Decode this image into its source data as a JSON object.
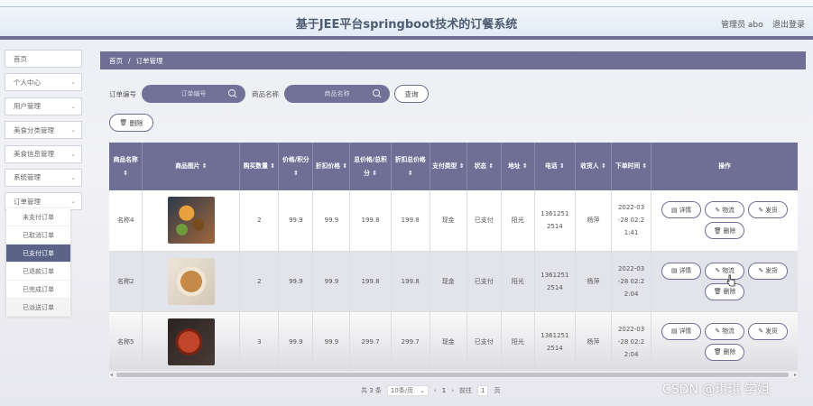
{
  "header": {
    "title": "基于JEE平台springboot技术的订餐系统",
    "user": "管理员 abo",
    "logout": "退出登录"
  },
  "sidebar": {
    "items": [
      {
        "label": "首页",
        "chevron": false
      },
      {
        "label": "个人中心",
        "chevron": true
      },
      {
        "label": "用户管理",
        "chevron": true
      },
      {
        "label": "美食分类管理",
        "chevron": true
      },
      {
        "label": "美食信息管理",
        "chevron": true
      },
      {
        "label": "系统管理",
        "chevron": true
      },
      {
        "label": "订单管理",
        "chevron": true
      }
    ],
    "submenu": [
      {
        "label": "未支付订单",
        "active": false
      },
      {
        "label": "已取消订单",
        "active": false
      },
      {
        "label": "已支付订单",
        "active": true
      },
      {
        "label": "已退款订单",
        "active": false
      },
      {
        "label": "已完成订单",
        "active": false
      },
      {
        "label": "已派送订单",
        "active": false
      }
    ]
  },
  "breadcrumb": {
    "home": "首页",
    "sep": "/",
    "current": "订单管理"
  },
  "search": {
    "order_no_label": "订单编号",
    "order_no_placeholder": "订单编号",
    "goods_name_label": "商品名称",
    "goods_name_placeholder": "商品名称",
    "query_button": "查询",
    "delete_button": "删除"
  },
  "table": {
    "headers": [
      "商品名称 ⇕",
      "商品图片 ⇕",
      "购买数量 ⇕",
      "价格/积分 ⇕",
      "折扣价格 ⇕",
      "总价格/总积分 ⇕",
      "折扣总价格 ⇕",
      "支付类型 ⇕",
      "状态 ⇕",
      "地址 ⇕",
      "电话 ⇕",
      "收货人 ⇕",
      "下单时间 ⇕",
      "操作"
    ],
    "rows": [
      {
        "name": "名称4",
        "qty": "2",
        "price": "99.9",
        "discount_price": "99.9",
        "total": "199.8",
        "discount_total": "199.8",
        "pay_type": "现金",
        "status": "已支付",
        "address": "阳光",
        "phone": "1361251 2514",
        "receiver": "杨萍",
        "time": "2022-03 -28 02:2 1:41"
      },
      {
        "name": "名称2",
        "qty": "2",
        "price": "99.9",
        "discount_price": "99.9",
        "total": "199.8",
        "discount_total": "199.8",
        "pay_type": "现金",
        "status": "已支付",
        "address": "阳光",
        "phone": "1361251 2514",
        "receiver": "杨萍",
        "time": "2022-03 -28 02:2 2:04"
      },
      {
        "name": "名称5",
        "qty": "3",
        "price": "99.9",
        "discount_price": "99.9",
        "total": "299.7",
        "discount_total": "299.7",
        "pay_type": "现金",
        "status": "已支付",
        "address": "阳光",
        "phone": "1361251 2514",
        "receiver": "杨萍",
        "time": "2022-03 -28 02:2 2:04"
      }
    ],
    "ops": {
      "detail": "详情",
      "logistics": "物流",
      "ship": "发货",
      "delete": "删除"
    }
  },
  "pager": {
    "total": "共 3 条",
    "page_size": "10条/页",
    "page": "1",
    "goto_label": "前往",
    "goto_value": "1",
    "page_unit": "页"
  },
  "watermark": "CSDN @琪琪 学姐",
  "colors": {
    "accent": "#6f6f96",
    "active_menu": "#5b6488"
  }
}
